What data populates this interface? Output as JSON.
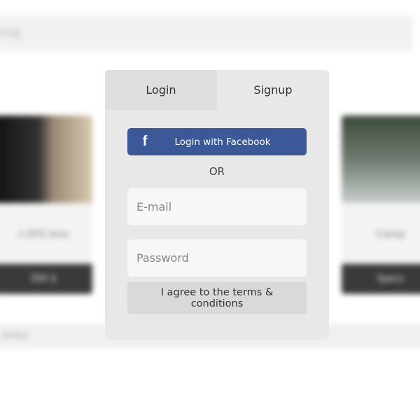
{
  "background": {
    "search_placeholder": "ning",
    "left_card": {
      "name": "n EFS lens",
      "price": "350 $"
    },
    "right_card": {
      "name": "Comp",
      "price": "Specs"
    },
    "footer_text": "Online"
  },
  "auth": {
    "tabs": [
      {
        "label": "Login",
        "active": false
      },
      {
        "label": "Signup",
        "active": true
      }
    ],
    "facebook_button": {
      "label": "Login with Facebook",
      "icon": "facebook-f-icon",
      "color": "#3b5998"
    },
    "divider": "OR",
    "email_field": {
      "placeholder": "E-mail",
      "value": ""
    },
    "password_field": {
      "placeholder": "Password",
      "value": ""
    },
    "terms_label": "I agree to the terms & conditions"
  }
}
